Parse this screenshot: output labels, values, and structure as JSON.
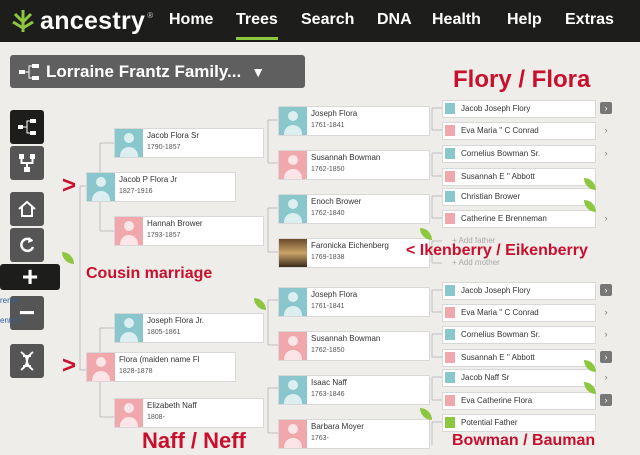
{
  "nav": {
    "logo": "ancestry",
    "tm": "®",
    "items": [
      "Home",
      "Trees",
      "Search",
      "DNA",
      "Health",
      "Help",
      "Extras"
    ],
    "active": "Trees"
  },
  "tree_selector": {
    "title": "Lorraine Frantz Family..."
  },
  "sidebar": {
    "frag1": "ren ▾",
    "frag2": "entz J"
  },
  "people": [
    {
      "id": "p1",
      "name": "Jacob P Flora Jr",
      "dates": "1827-1916",
      "g": "m"
    },
    {
      "id": "p2",
      "name": "Flora (maiden name Fl",
      "dates": "1828-1878",
      "g": "f"
    },
    {
      "id": "p3",
      "name": "Jacob Flora Sr",
      "dates": "1790-1857",
      "g": "m"
    },
    {
      "id": "p4",
      "name": "Hannah Brower",
      "dates": "1793-1857",
      "g": "f"
    },
    {
      "id": "p5",
      "name": "Joseph Flora Jr.",
      "dates": "1805-1861",
      "g": "m"
    },
    {
      "id": "p6",
      "name": "Elizabeth Naff",
      "dates": "1808-",
      "g": "f"
    },
    {
      "id": "p7",
      "name": "Joseph Flora",
      "dates": "1761-1841",
      "g": "m"
    },
    {
      "id": "p8",
      "name": "Susannah Bowman",
      "dates": "1762-1850",
      "g": "f"
    },
    {
      "id": "p9",
      "name": "Enoch Brower",
      "dates": "1762-1840",
      "g": "m"
    },
    {
      "id": "p10",
      "name": "Faronicka Eichenberg",
      "dates": "1769-1838",
      "g": "img"
    },
    {
      "id": "p11",
      "name": "Joseph Flora",
      "dates": "1761-1841",
      "g": "m"
    },
    {
      "id": "p12",
      "name": "Susannah Bowman",
      "dates": "1762-1850",
      "g": "f"
    },
    {
      "id": "p13",
      "name": "Isaac Naff",
      "dates": "1763-1846",
      "g": "m"
    },
    {
      "id": "p14",
      "name": "Barbara Moyer",
      "dates": "1763-",
      "g": "f"
    }
  ],
  "ancestors": [
    {
      "name": "Jacob Joseph Flory",
      "g": "m"
    },
    {
      "name": "Eva Maria '' C Conrad",
      "g": "f"
    },
    {
      "name": "Cornelius Bowman Sr.",
      "g": "m"
    },
    {
      "name": "Susannah E '' Abbott",
      "g": "f"
    },
    {
      "name": "Christian Brower",
      "g": "m"
    },
    {
      "name": "Catherine E Brenneman",
      "g": "f"
    },
    {
      "name": "Jacob Joseph Flory",
      "g": "m"
    },
    {
      "name": "Eva Maria '' C Conrad",
      "g": "f"
    },
    {
      "name": "Cornelius Bowman Sr.",
      "g": "m"
    },
    {
      "name": "Susannah E '' Abbott",
      "g": "f"
    },
    {
      "name": "Jacob Naff Sr",
      "g": "m"
    },
    {
      "name": "Eva Catherine Flora",
      "g": "f"
    },
    {
      "name": "Potential Father",
      "g": "potential"
    }
  ],
  "add_slots": {
    "father": "+ Add father",
    "mother": "+ Add mother"
  },
  "annotations": {
    "flory": "Flory / Flora",
    "cousin": "Cousin marriage",
    "ikenberry": "< Ikenberry / Eikenberry",
    "naff": "Naff / Neff",
    "bowman": "Bowman / Bauman",
    "gt": ">"
  },
  "colors": {
    "accent": "#8dc63f",
    "annotation": "#c8102e",
    "male": "#89c7cc",
    "female": "#f0a8ad"
  }
}
